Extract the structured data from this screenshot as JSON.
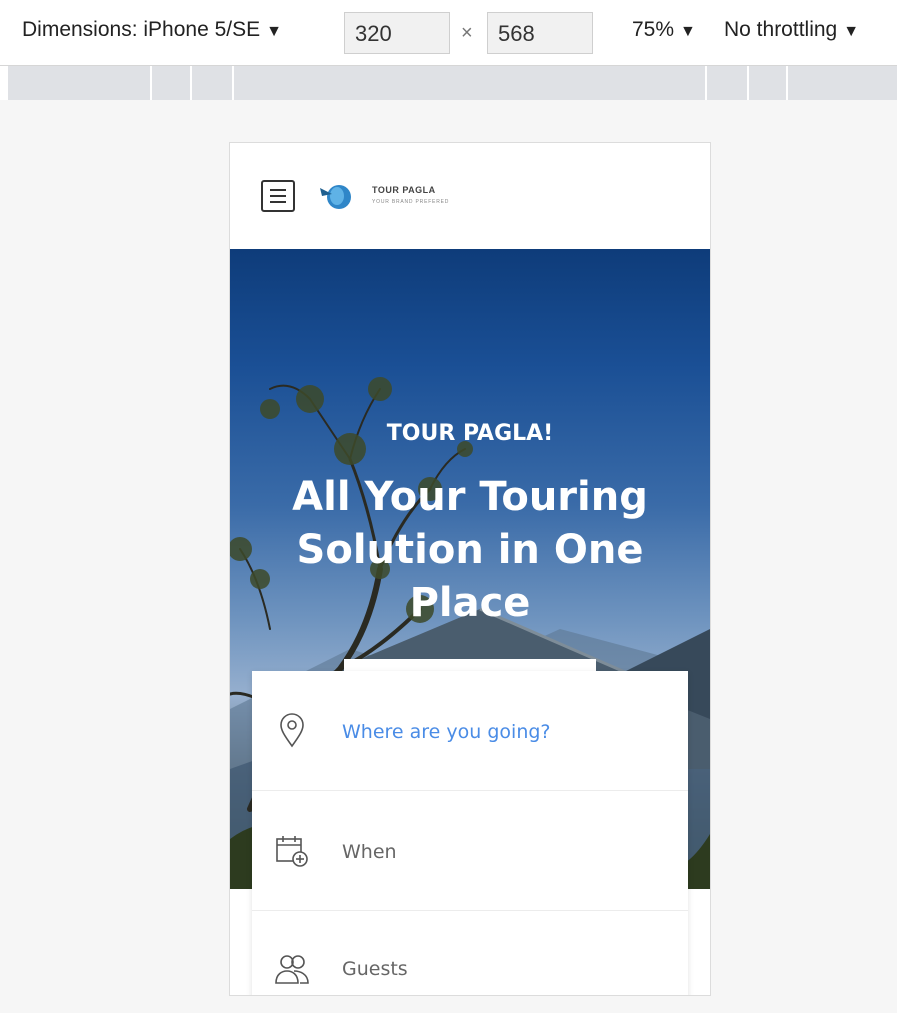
{
  "toolbar": {
    "device_label": "Dimensions: iPhone 5/SE",
    "width": "320",
    "height": "568",
    "separator": "×",
    "zoom": "75%",
    "throttling": "No throttling",
    "caret": "▼"
  },
  "site": {
    "brand": "TOUR PAGLA",
    "tagline": "YOUR BRAND PREFERED"
  },
  "hero": {
    "subtitle": "TOUR PAGLA!",
    "title": "All Your Touring Solution in One Place"
  },
  "search": {
    "where_placeholder": "Where are you going?",
    "when_label": "When",
    "guests_label": "Guests"
  },
  "colors": {
    "accent": "#4a8ce6"
  }
}
